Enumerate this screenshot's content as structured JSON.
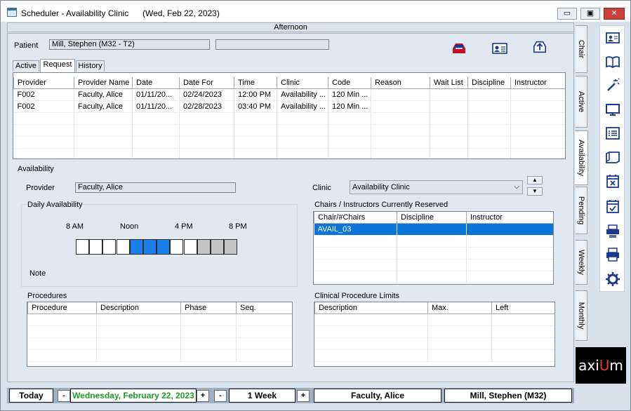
{
  "window": {
    "title": "Scheduler - Availability Clinic",
    "date": "(Wed, Feb 22, 2023)",
    "minimize": "▭",
    "maximize": "▣",
    "close": "✕"
  },
  "top_strip": "Afternoon",
  "patient": {
    "label": "Patient",
    "name": "Mill, Stephen (M32 - T2)",
    "extra": ""
  },
  "tabs": [
    {
      "label": "Active"
    },
    {
      "label": "Request"
    },
    {
      "label": "History"
    }
  ],
  "request_table": {
    "columns": [
      "Provider",
      "Provider Name",
      "Date",
      "Date For",
      "Time",
      "Clinic",
      "Code",
      "Reason",
      "Wait List",
      "Discipline",
      "Instructor"
    ],
    "rows": [
      [
        "F002",
        "Faculty, Alice",
        "01/11/20...",
        "02/24/2023",
        "12:00 PM",
        "Availability ...",
        "120 Min ...",
        "",
        "",
        "",
        ""
      ],
      [
        "F002",
        "Faculty, Alice",
        "01/11/20...",
        "02/28/2023",
        "03:40 PM",
        "Availability ...",
        "120 Min ...",
        "",
        "",
        "",
        ""
      ]
    ]
  },
  "availability": {
    "section_label": "Availability",
    "provider_label": "Provider",
    "provider_value": "Faculty, Alice",
    "clinic_label": "Clinic",
    "clinic_value": "Availability Clinic",
    "daily_label": "Daily Availability",
    "hour_labels": [
      "8 AM",
      "Noon",
      "4 PM",
      "8 PM"
    ],
    "slots": [
      "open",
      "open",
      "open",
      "open",
      "booked",
      "booked",
      "booked",
      "open",
      "open",
      "closed",
      "closed",
      "closed"
    ],
    "note_label": "Note",
    "chairs": {
      "label": "Chairs / Instructors Currently Reserved",
      "columns": [
        "Chair/#Chairs",
        "Discipline",
        "Instructor"
      ],
      "rows": [
        [
          "AVAIL_03",
          "",
          ""
        ]
      ]
    },
    "procedures": {
      "label": "Procedures",
      "columns": [
        "Procedure",
        "Description",
        "Phase",
        "Seq."
      ]
    },
    "limits": {
      "label": "Clinical Procedure Limits",
      "columns": [
        "Description",
        "Max.",
        "Left"
      ]
    }
  },
  "side_tabs": [
    "Chair",
    "Active",
    "Availability",
    "Pending",
    "Weekly",
    "Monthly"
  ],
  "icons": [
    "patient-card-icon",
    "book-icon",
    "magic-wand-icon",
    "monitor-icon",
    "list-icon",
    "folder-icon",
    "calendar-x-icon",
    "calendar-check-icon",
    "print-list-icon",
    "printer-icon",
    "settings-icon"
  ],
  "logo": {
    "prefix": "axi",
    "highlight": "U",
    "suffix": "m"
  },
  "bottom": {
    "today": "Today",
    "minus": "-",
    "plus": "+",
    "date": "Wednesday, February 22, 2023",
    "range": "1 Week",
    "provider": "Faculty, Alice",
    "patient": "Mill, Stephen  (M32)"
  },
  "colors": {
    "selected_row": "#0a74d9",
    "booked_slot": "#1a7fea",
    "closed_slot": "#c2c4c6",
    "date_text": "#1e9a2a",
    "close_button": "#c9403a",
    "logo_accent": "#e33c2e"
  }
}
